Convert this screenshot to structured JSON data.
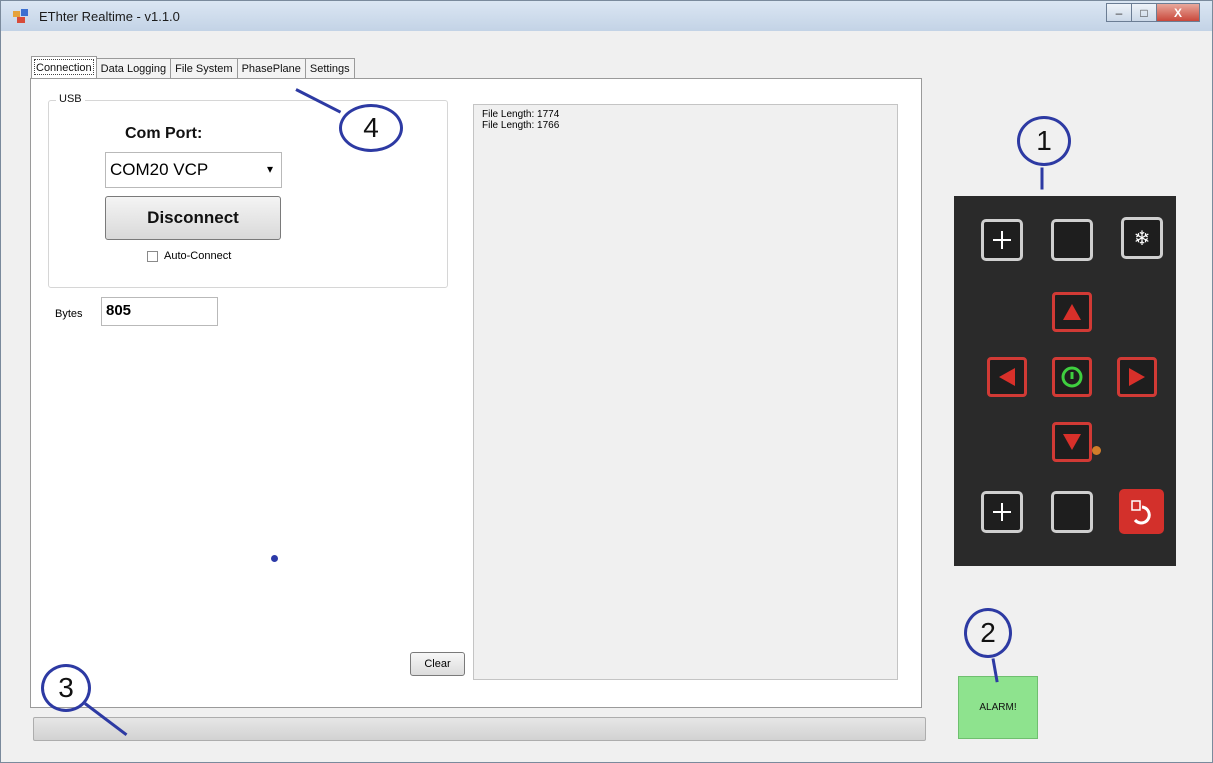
{
  "window": {
    "title": "EThter Realtime - v1.1.0",
    "controls": {
      "minimize": "–",
      "maximize": "□",
      "close": "X"
    }
  },
  "tabs": [
    {
      "label": "Connection",
      "active": true
    },
    {
      "label": "Data Logging"
    },
    {
      "label": "File System"
    },
    {
      "label": "PhasePlane"
    },
    {
      "label": "Settings"
    }
  ],
  "usb": {
    "legend": "USB",
    "com_port_label": "Com Port:",
    "com_port_value": "COM20 VCP",
    "disconnect_label": "Disconnect",
    "auto_connect_label": "Auto-Connect",
    "auto_connect_checked": false
  },
  "bytes": {
    "label": "Bytes",
    "value": "805"
  },
  "log": {
    "lines": [
      "File Length: 1774",
      "File Length: 1766"
    ]
  },
  "clear_label": "Clear",
  "alarm_label": "ALARM!",
  "annotations": [
    "1",
    "2",
    "3",
    "4"
  ],
  "keypad": {
    "icons": [
      "plus-icon",
      "blank-key",
      "snowflake-icon",
      "up-arrow-icon",
      "left-arrow-icon",
      "power-icon",
      "right-arrow-icon",
      "down-arrow-icon",
      "plus-icon",
      "blank-key",
      "return-icon"
    ],
    "colors": {
      "panel": "#2a2a2a",
      "white_key": "#cfcfcf",
      "red_key": "#d13a35",
      "power": "#3fcf3f",
      "led": "#d07d2a"
    }
  },
  "colors": {
    "alarm_bg": "#8ee38e",
    "annotation": "#2d3aa3"
  }
}
